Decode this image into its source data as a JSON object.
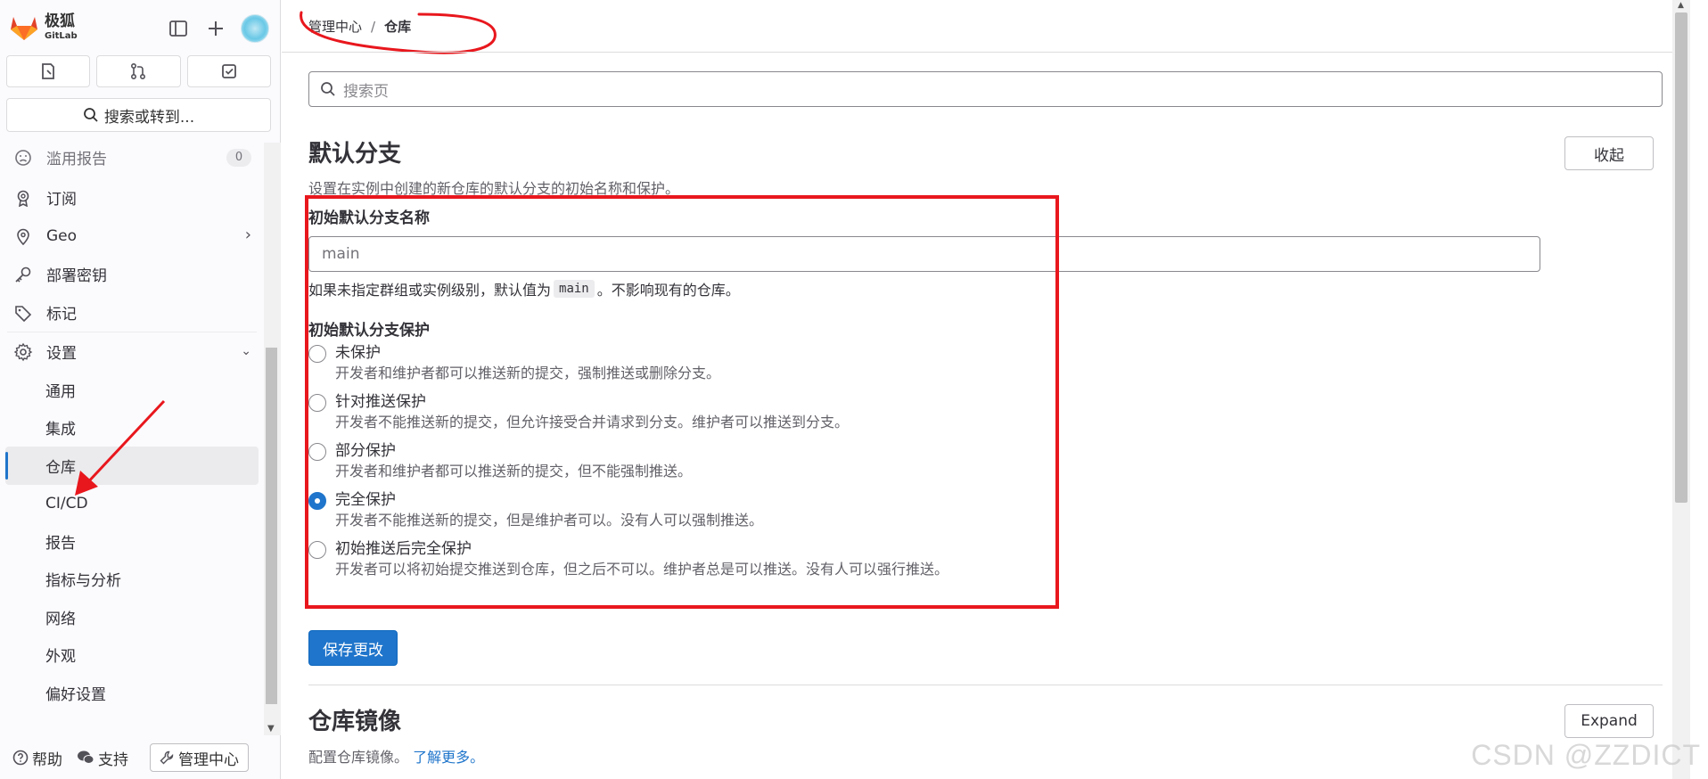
{
  "brand": {
    "name": "极狐",
    "sub": "GitLab"
  },
  "sidebar": {
    "search_label": "搜索或转到...",
    "items": [
      {
        "label": "滥用报告",
        "badge": "0"
      },
      {
        "label": "订阅"
      },
      {
        "label": "Geo"
      },
      {
        "label": "部署密钥"
      },
      {
        "label": "标记"
      },
      {
        "label": "设置"
      }
    ],
    "settings_sub": [
      "通用",
      "集成",
      "仓库",
      "CI/CD",
      "报告",
      "指标与分析",
      "网络",
      "外观",
      "偏好设置"
    ],
    "active": "仓库",
    "footer": {
      "help": "帮助",
      "support": "支持",
      "admin": "管理中心"
    }
  },
  "breadcrumb": {
    "parent": "管理中心",
    "separator": "/",
    "current": "仓库"
  },
  "search": {
    "placeholder": "搜索页"
  },
  "default_branch": {
    "title": "默认分支",
    "description": "设置在实例中创建的新仓库的默认分支的初始名称和保护。",
    "collapse_label": "收起",
    "name_label": "初始默认分支名称",
    "name_placeholder": "main",
    "help_prefix": "如果未指定群组或实例级别，默认值为",
    "help_code": "main",
    "help_suffix": "。不影响现有的仓库。",
    "protection_label": "初始默认分支保护",
    "options": [
      {
        "label": "未保护",
        "desc": "开发者和维护者都可以推送新的提交，强制推送或删除分支。",
        "checked": false
      },
      {
        "label": "针对推送保护",
        "desc": "开发者不能推送新的提交，但允许接受合并请求到分支。维护者可以推送到分支。",
        "checked": false
      },
      {
        "label": "部分保护",
        "desc": "开发者和维护者都可以推送新的提交，但不能强制推送。",
        "checked": false
      },
      {
        "label": "完全保护",
        "desc": "开发者不能推送新的提交，但是维护者可以。没有人可以强制推送。",
        "checked": true
      },
      {
        "label": "初始推送后完全保护",
        "desc": "开发者可以将初始提交推送到仓库，但之后不可以。维护者总是可以推送。没有人可以强行推送。",
        "checked": false
      }
    ],
    "save_label": "保存更改"
  },
  "mirror": {
    "title": "仓库镜像",
    "description": "配置仓库镜像。",
    "learn_more": "了解更多。",
    "expand_label": "Expand"
  },
  "watermark": "CSDN @ZZDICT",
  "colors": {
    "primary": "#1f75cb",
    "annotation": "#e8171d",
    "brand_orange": "#e24329"
  }
}
